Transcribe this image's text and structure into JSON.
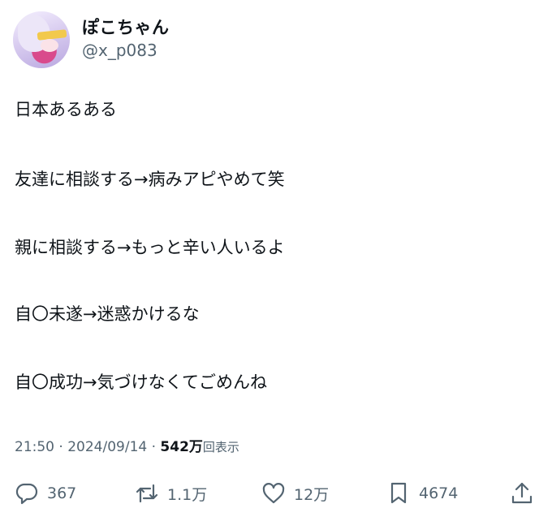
{
  "user": {
    "display_name": "ぽこちゃん",
    "handle": "@x_p083"
  },
  "post": {
    "lines": [
      "日本あるある",
      "友達に相談する→病みアピやめて笑",
      "親に相談する→もっと辛い人いるよ",
      "自〇未遂→迷惑かけるな",
      "自〇成功→気づけなくてごめんね"
    ]
  },
  "meta": {
    "time": "21:50",
    "sep1": " · ",
    "date": "2024/09/14",
    "sep2": " · ",
    "views_count": "542万",
    "views_label": "回表示"
  },
  "actions": {
    "replies": "367",
    "reposts": "1.1万",
    "likes": "12万",
    "bookmarks": "4674"
  },
  "icons": [
    "reply-icon",
    "repost-icon",
    "like-icon",
    "bookmark-icon",
    "share-icon"
  ]
}
